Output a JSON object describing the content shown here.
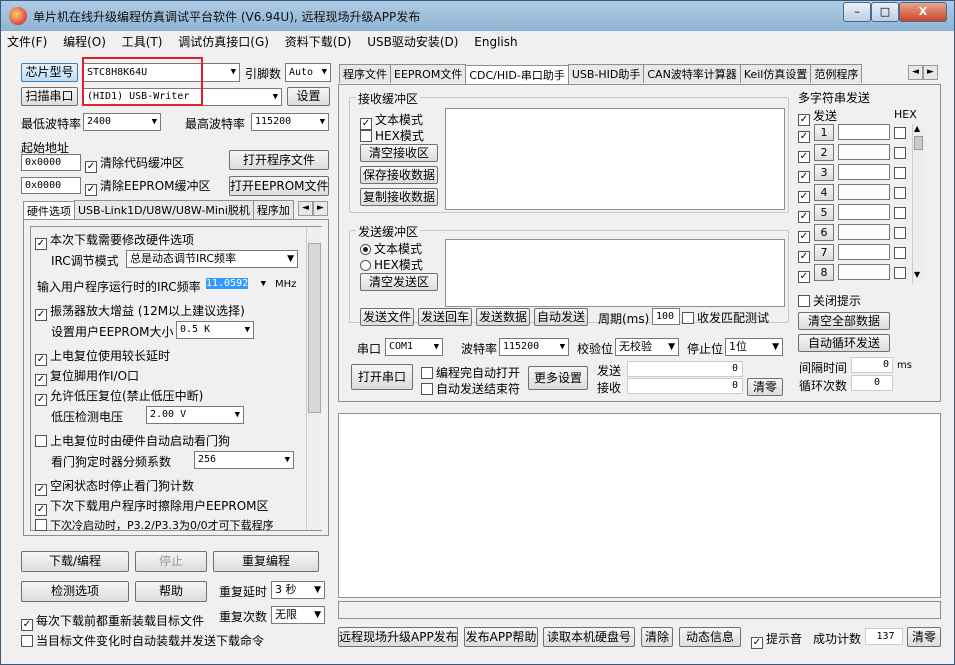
{
  "window": {
    "title": "单片机在线升级编程仿真调试平台软件 (V6.94U), 远程现场升级APP发布"
  },
  "caption": {
    "minimize": "–",
    "maximize": "□",
    "close": "X"
  },
  "menu": [
    "文件(F)",
    "编程(O)",
    "工具(T)",
    "调试仿真接口(G)",
    "资料下载(D)",
    "USB驱动安装(D)",
    "English"
  ],
  "left": {
    "chip_btn": "芯片型号",
    "chip_value": "STC8H8K64U",
    "pin_label": "引脚数",
    "pin_value": "Auto",
    "scan_btn": "扫描串口",
    "port_value": "(HID1) USB-Writer",
    "settings_btn": "设置",
    "min_baud_label": "最低波特率",
    "min_baud": "2400",
    "max_baud_label": "最高波特率",
    "max_baud": "115200",
    "start_addr_label": "起始地址",
    "addr1": "0x0000",
    "clear_code": "清除代码缓冲区",
    "open_prog": "打开程序文件",
    "addr2": "0x0000",
    "clear_eeprom": "清除EEPROM缓冲区",
    "open_eeprom": "打开EEPROM文件",
    "tabs": [
      "硬件选项",
      "USB-Link1D/U8W/U8W-Mini脱机",
      "程序加"
    ],
    "opt_modify_hw": "本次下载需要修改硬件选项",
    "irc_mode_label": "IRC调节模式",
    "irc_mode_value": "总是动态调节IRC频率",
    "irc_freq_label": "输入用户程序运行时的IRC频率",
    "irc_freq_value": "11.0592",
    "irc_unit": "MHz",
    "osc_gain": "振荡器放大增益 (12M以上建议选择)",
    "eeprom_size_label": "设置用户EEPROM大小",
    "eeprom_size_value": "0.5 K",
    "power_delay": "上电复位使用较长延时",
    "reset_io": "复位脚用作I/O口",
    "lvd_reset": "允许低压复位(禁止低压中断)",
    "lvd_label": "低压检测电压",
    "lvd_value": "2.00 V",
    "wdt_auto": "上电复位时由硬件自动启动看门狗",
    "wdt_div_label": "看门狗定时器分频系数",
    "wdt_div_value": "256",
    "idle_wdt": "空闲状态时停止看门狗计数",
    "erase_eeprom": "下次下载用户程序时擦除用户EEPROM区",
    "p32p33": "下次冷启动时，P3.2/P3.3为0/0才可下载程序",
    "download_btn": "下载/编程",
    "stop_btn": "停止",
    "reprog_btn": "重复编程",
    "detect_btn": "检测选项",
    "help_btn": "帮助",
    "repeat_delay_label": "重复延时",
    "repeat_delay_value": "3 秒",
    "repeat_count_label": "重复次数",
    "repeat_count_value": "无限",
    "reload_before": "每次下载前都重新装载目标文件",
    "auto_load": "当目标文件变化时自动装载并发送下载命令"
  },
  "right": {
    "tabs": [
      "程序文件",
      "EEPROM文件",
      "CDC/HID-串口助手",
      "USB-HID助手",
      "CAN波特率计算器",
      "Keil仿真设置",
      "范例程序"
    ],
    "recv_group": "接收缓冲区",
    "recv_text": "文本模式",
    "recv_hex": "HEX模式",
    "clear_recv": "清空接收区",
    "save_recv": "保存接收数据",
    "copy_recv": "复制接收数据",
    "send_group": "发送缓冲区",
    "send_text": "文本模式",
    "send_hex": "HEX模式",
    "clear_send": "清空发送区",
    "send_file": "发送文件",
    "send_cr": "发送回车",
    "send_data": "发送数据",
    "auto_send": "自动发送",
    "period_label": "周期(ms)",
    "period_value": "100",
    "match_test": "收发匹配测试",
    "port_label": "串口",
    "port_value": "COM1",
    "baud_label": "波特率",
    "baud_value": "115200",
    "parity_label": "校验位",
    "parity_value": "无校验",
    "stop_label": "停止位",
    "stop_value": "1位",
    "open_port": "打开串口",
    "auto_open": "编程完自动打开",
    "auto_close": "自动发送结束符",
    "more_settings": "更多设置",
    "send_label": "发送",
    "send_count": "0",
    "recv_label": "接收",
    "recv_count": "0",
    "clear_count": "清零",
    "multi_group": "多字符串发送",
    "multi_send": "发送",
    "multi_hex": "HEX",
    "rows": [
      "1",
      "2",
      "3",
      "4",
      "5",
      "6",
      "7",
      "8"
    ],
    "close_tip": "关闭提示",
    "clear_all": "清空全部数据",
    "auto_loop": "自动循环发送",
    "interval_label": "间隔时间",
    "interval_value": "0",
    "interval_unit": "ms",
    "loop_label": "循环次数",
    "loop_value": "0"
  },
  "bottom": {
    "remote_app": "远程现场升级APP发布",
    "app_help": "发布APP帮助",
    "read_disk": "读取本机硬盘号",
    "clear": "清除",
    "dynamic_info": "动态信息",
    "tip_sound": "提示音",
    "success_label": "成功计数",
    "success_value": "137",
    "clear_zero": "清零"
  },
  "colors": {
    "highlight": "#3399ff",
    "annotation_box": "#e0202a"
  }
}
